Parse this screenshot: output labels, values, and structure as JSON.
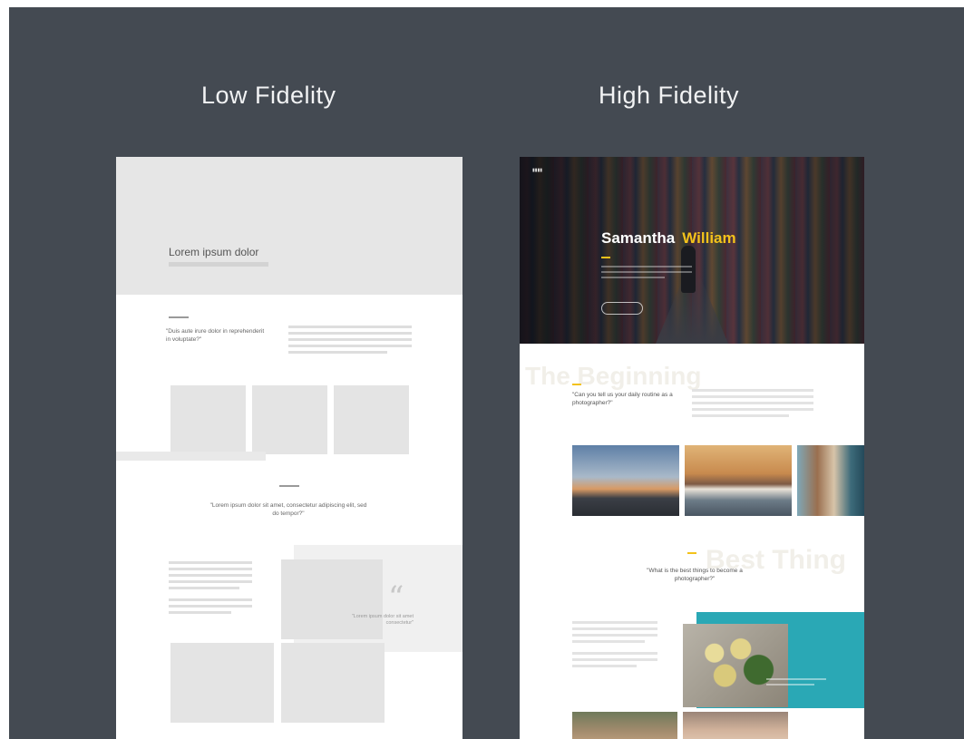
{
  "columns": {
    "low": {
      "title": "Low Fidelity"
    },
    "high": {
      "title": "High Fidelity"
    }
  },
  "lofi": {
    "hero_title": "Lorem ipsum dolor",
    "question1": "\"Duis aute irure dolor in reprehenderit in voluptate?\"",
    "question2": "\"Lorem ipsum dolor sit amet, consectetur adipiscing elit, sed do tempor?\"",
    "quote_mark": "“",
    "quote_text": "\"Lorem ipsum dolor sit amet consectetur\""
  },
  "hifi": {
    "hero_first_name": "Samantha",
    "hero_last_name": "William",
    "ghost_word_1": "The Beginning",
    "ghost_word_2": "Best Thing",
    "question1": "\"Can you tell us your daily routine as a photographer?\"",
    "question2": "\"What is the best things to become a photographer?\"",
    "colors": {
      "accent": "#f3c21b",
      "teal": "#2aa8b5",
      "backdrop": "#444a52"
    }
  }
}
